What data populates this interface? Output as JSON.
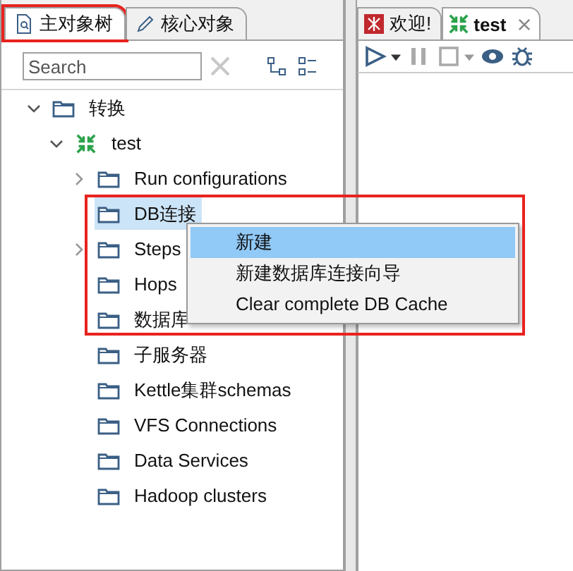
{
  "left_tabs": [
    {
      "label": "主对象树",
      "selected": true,
      "highlighted": true
    },
    {
      "label": "核心对象",
      "selected": false,
      "highlighted": false
    }
  ],
  "search": {
    "placeholder": "Search"
  },
  "tree": [
    {
      "label": "转换",
      "kind": "folder",
      "expandable": true,
      "expanded": true,
      "selected": false,
      "children": [
        {
          "label": "test",
          "kind": "transformation",
          "expandable": true,
          "expanded": true,
          "selected": false,
          "children": [
            {
              "label": "Run configurations",
              "kind": "folder",
              "expandable": true,
              "expanded": false,
              "selected": false
            },
            {
              "label": "DB连接",
              "kind": "folder",
              "expandable": false,
              "selected": true
            },
            {
              "label": "Steps",
              "kind": "folder",
              "expandable": true,
              "expanded": false,
              "selected": false
            },
            {
              "label": "Hops",
              "kind": "folder",
              "expandable": false,
              "selected": false
            },
            {
              "label": "数据库",
              "kind": "folder",
              "expandable": false,
              "selected": false
            },
            {
              "label": "子服务器",
              "kind": "folder",
              "expandable": false,
              "selected": false
            },
            {
              "label": "Kettle集群schemas",
              "kind": "folder",
              "expandable": false,
              "selected": false
            },
            {
              "label": "VFS Connections",
              "kind": "folder",
              "expandable": false,
              "selected": false
            },
            {
              "label": "Data Services",
              "kind": "folder",
              "expandable": false,
              "selected": false
            },
            {
              "label": "Hadoop clusters",
              "kind": "folder",
              "expandable": false,
              "selected": false
            }
          ]
        }
      ]
    }
  ],
  "right_tabs": [
    {
      "label": "欢迎!",
      "kind": "welcome",
      "selected": false,
      "closable": false
    },
    {
      "label": "test",
      "kind": "transformation",
      "selected": true,
      "closable": true
    }
  ],
  "context_menu": {
    "highlighted": true,
    "items": [
      {
        "label": "新建",
        "selected": true
      },
      {
        "label": "新建数据库连接向导",
        "selected": false
      },
      {
        "label": "Clear complete DB Cache",
        "selected": false
      }
    ]
  }
}
